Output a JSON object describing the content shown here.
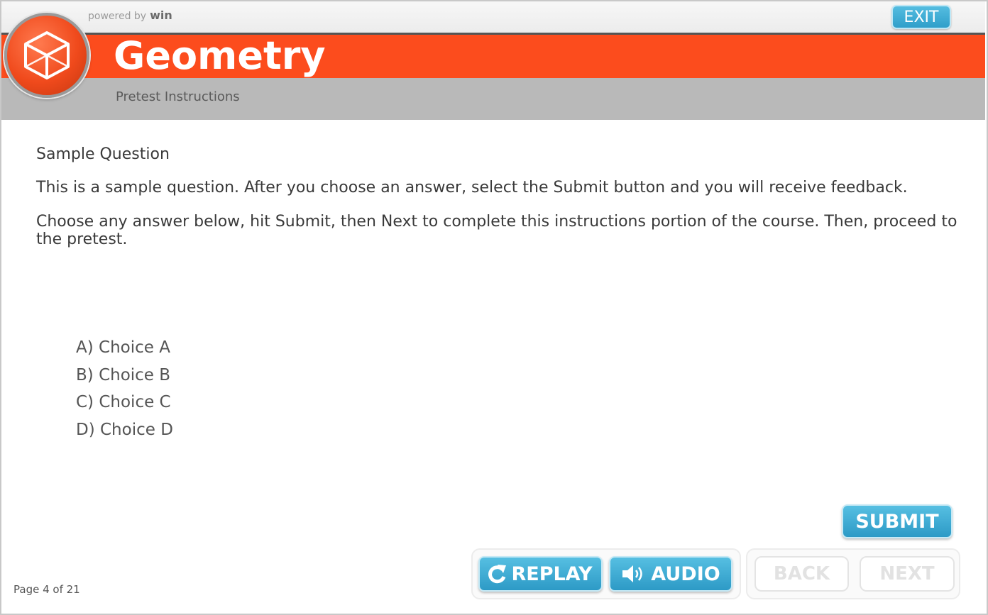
{
  "header": {
    "powered_by": "powered by",
    "powered_brand": "win",
    "exit_label": "EXIT",
    "course_title": "Geometry",
    "section_title": "Pretest Instructions",
    "logo_icon": "cube-icon"
  },
  "question": {
    "title": "Sample Question",
    "paragraph1": "This is a sample question. After you choose an answer, select the Submit button and you will receive feedback.",
    "paragraph2": "Choose any answer below, hit Submit, then Next to complete this instructions portion of the course. Then, proceed to the pretest.",
    "choices": [
      {
        "label": "A) Choice A"
      },
      {
        "label": "B) Choice B"
      },
      {
        "label": "C) Choice C"
      },
      {
        "label": "D) Choice D"
      }
    ]
  },
  "controls": {
    "submit_label": "SUBMIT",
    "replay_label": "REPLAY",
    "replay_icon": "replay-icon",
    "audio_label": "AUDIO",
    "audio_icon": "speaker-icon",
    "back_label": "BACK",
    "next_label": "NEXT"
  },
  "footer": {
    "page_indicator": "Page 4 of 21"
  },
  "colors": {
    "banner": "#fc4c1d",
    "subheader": "#b9b9b9",
    "button_blue": "#2f9fca",
    "disabled": "#e2e2e2"
  }
}
